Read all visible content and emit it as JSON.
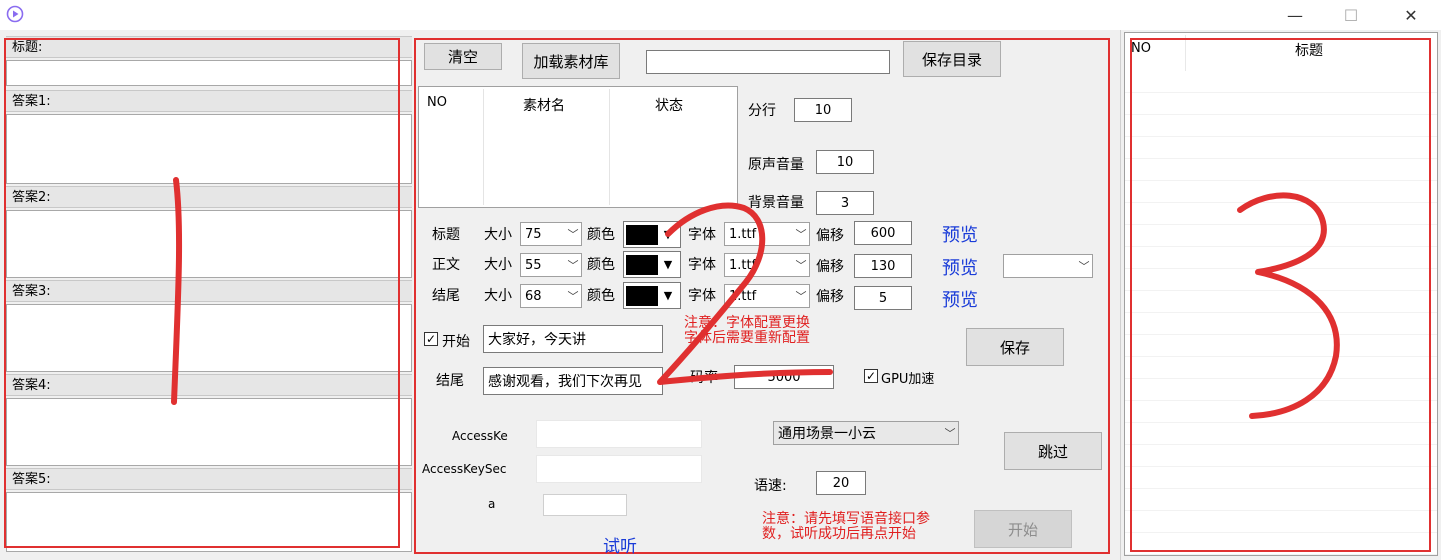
{
  "window": {
    "controls": {
      "minimize": "—",
      "maximize": "☐",
      "close": "✕"
    }
  },
  "left_panel": {
    "title_label": "标题:",
    "answers": [
      "答案1:",
      "答案2:",
      "答案3:",
      "答案4:",
      "答案5:"
    ]
  },
  "middle_panel": {
    "clear_button": "清空",
    "load_library_button": "加载素材库",
    "path_value": "",
    "save_dir_button": "保存目录",
    "material_list": {
      "headers": [
        "NO",
        "素材名",
        "状态"
      ]
    },
    "line_break_label": "分行",
    "line_break_value": "10",
    "orig_volume_label": "原声音量",
    "orig_volume_value": "10",
    "bg_volume_label": "背景音量",
    "bg_volume_value": "3",
    "style_rows": [
      {
        "name": "标题",
        "size_label": "大小",
        "size": "75",
        "color_label": "颜色",
        "font_label": "字体",
        "font": "1.ttf",
        "offset_label": "偏移",
        "offset": "600",
        "preview": "预览"
      },
      {
        "name": "正文",
        "size_label": "大小",
        "size": "55",
        "color_label": "颜色",
        "font_label": "字体",
        "font": "1.ttf",
        "offset_label": "偏移",
        "offset": "130",
        "preview": "预览"
      },
      {
        "name": "结尾",
        "size_label": "大小",
        "size": "68",
        "color_label": "颜色",
        "font_label": "字体",
        "font": "1.ttf",
        "offset_label": "偏移",
        "offset": "5",
        "preview": "预览"
      }
    ],
    "extra_select_value": "",
    "start_checkbox_label": "开始",
    "start_text": "大家好，今天讲",
    "end_label": "结尾",
    "end_text": "感谢观看，我们下次再见",
    "note_font": "注意：字体配置更换\n字体后需要重新配置",
    "save_button": "保存",
    "bitrate_label": "码率",
    "bitrate_value": "5000",
    "gpu_label": "GPU加速",
    "access_key_label": "AccessKe",
    "access_key_secret_label": "AccessKeySec",
    "appkey_label": "a",
    "appkey_value": "",
    "scene_select": "通用场景一小云",
    "skip_button": "跳过",
    "speed_label": "语速:",
    "speed_value": "20",
    "note_voice": "注意：请先填写语音接口参\n数，试听成功后再点开始",
    "start_button": "开始",
    "listen_link": "试听"
  },
  "right_panel": {
    "headers": [
      "NO",
      "标题"
    ]
  },
  "annotations": {
    "left": "1",
    "middle": "2",
    "right": "3"
  },
  "colors": {
    "annotation_red": "#e03030",
    "link_blue": "#1a3cd8",
    "note_red": "#e02020"
  },
  "icons": [
    "app-logo-icon",
    "minimize-icon",
    "maximize-icon",
    "close-icon",
    "chevron-down-icon",
    "checkmark-icon"
  ]
}
